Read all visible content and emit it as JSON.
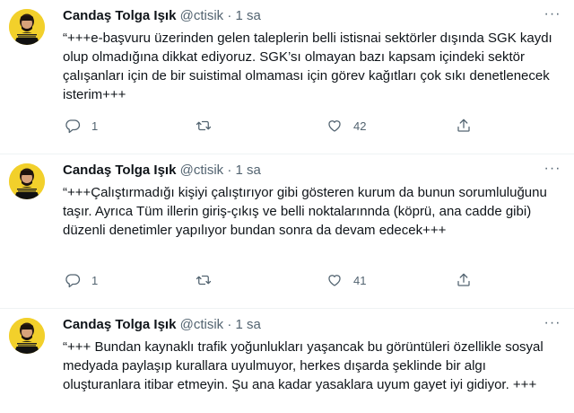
{
  "tweets": [
    {
      "name": "Candaş Tolga Işık",
      "handle": "@ctisik",
      "separator": "·",
      "time": "1 sa",
      "text": "“+++e-başvuru üzerinden gelen taleplerin belli istisnai sektörler dışında SGK kaydı olup olmadığına dikkat ediyoruz. SGK’sı olmayan bazı kapsam içindeki sektör çalışanları için de bir suistimal olmaması için görev kağıtları çok sıkı denetlenecek isterim+++",
      "replies": "1",
      "retweets": "",
      "likes": "42"
    },
    {
      "name": "Candaş Tolga Işık",
      "handle": "@ctisik",
      "separator": "·",
      "time": "1 sa",
      "text": "“+++Çalıştırmadığı kişiyi çalıştırıyor gibi gösteren kurum da bunun sorumluluğunu taşır. Ayrıca Tüm illerin giriş-çıkış ve belli noktalarınnda (köprü, ana cadde gibi) düzenli denetimler yapılıyor bundan sonra da devam edecek+++",
      "replies": "1",
      "retweets": "",
      "likes": "41"
    },
    {
      "name": "Candaş Tolga Işık",
      "handle": "@ctisik",
      "separator": "·",
      "time": "1 sa",
      "text": "“+++ Bundan kaynaklı trafik yoğunlukları yaşancak bu görüntüleri özellikle sosyal medyada paylaşıp kurallara uyulmuyor, herkes dışarda şeklinde bir algı oluşturanlara itibar etmeyin. Şu ana kadar yasaklara uyum gayet iyi gidiyor. +++"
    }
  ],
  "more_glyph": "···",
  "colors": {
    "text": "#0f1419",
    "muted": "#536471",
    "divider": "#eff3f4",
    "avatar_bg": "#f2d02b"
  },
  "icons": [
    "reply-icon",
    "retweet-icon",
    "like-icon",
    "share-icon",
    "more-icon"
  ]
}
